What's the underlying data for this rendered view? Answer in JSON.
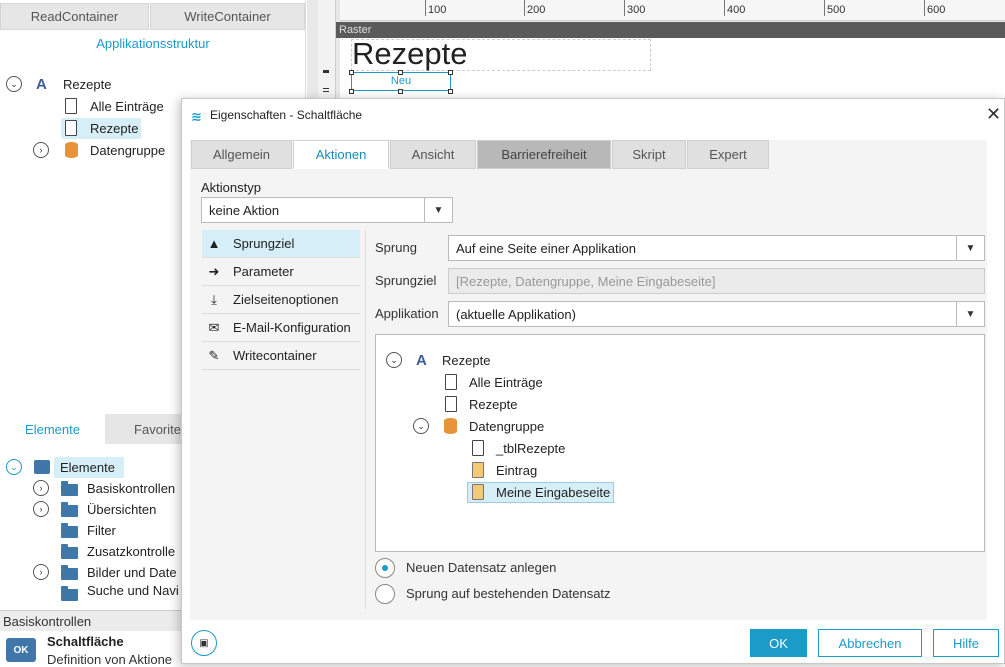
{
  "left": {
    "tabs": [
      "ReadContainer",
      "WriteContainer"
    ],
    "section_title": "Applikationsstruktur",
    "tree": {
      "root": "Rezepte",
      "items": [
        "Alle Einträge",
        "Rezepte",
        "Datengruppe"
      ]
    },
    "bottom_tabs": [
      "Elemente",
      "Favorite"
    ],
    "elements": {
      "root": "Elemente",
      "items": [
        "Basiskontrollen",
        "Übersichten",
        "Filter",
        "Zusatzkontrolle",
        "Bilder und Date",
        "Suche und Navi"
      ]
    },
    "info": {
      "category": "Basiskontrollen",
      "title": "Schaltfläche",
      "description": "Definition von Aktione",
      "icon_label": "OK"
    }
  },
  "canvas": {
    "ruler_ticks": [
      "100",
      "200",
      "300",
      "400",
      "500",
      "600"
    ],
    "raster_label": "Raster",
    "heading": "Rezepte",
    "button_label": "Neu"
  },
  "dialog": {
    "title": "Eigenschaften - Schaltfläche",
    "tabs": [
      "Allgemein",
      "Aktionen",
      "Ansicht",
      "Barrierefreiheit",
      "Skript",
      "Expert"
    ],
    "aktionstyp_label": "Aktionstyp",
    "aktionstyp_value": "keine Aktion",
    "side_items": [
      "Sprungziel",
      "Parameter",
      "Zielseitenoptionen",
      "E-Mail-Konfiguration",
      "Writecontainer"
    ],
    "sprung_label": "Sprung",
    "sprung_value": "Auf eine Seite einer Applikation",
    "sprungziel_label": "Sprungziel",
    "sprungziel_value": "[Rezepte, Datengruppe, Meine Eingabeseite]",
    "applikation_label": "Applikation",
    "applikation_value": "(aktuelle Applikation)",
    "tree": {
      "root": "Rezepte",
      "items": [
        "Alle Einträge",
        "Rezepte",
        "Datengruppe",
        "_tblRezepte",
        "Eintrag",
        "Meine Eingabeseite"
      ]
    },
    "radio1": "Neuen Datensatz anlegen",
    "radio2": "Sprung auf bestehenden Datensatz",
    "ok": "OK",
    "cancel": "Abbrechen",
    "help": "Hilfe"
  },
  "colors": {
    "accent": "#1a9bc8",
    "selected_bg": "#d6eef7",
    "orange": "#e8923a"
  }
}
